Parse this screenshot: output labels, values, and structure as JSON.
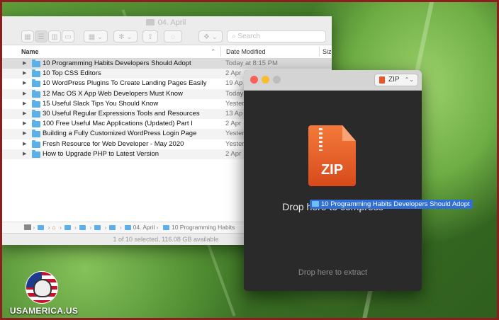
{
  "finder": {
    "title": "04. April",
    "search_placeholder": "Search",
    "columns": {
      "name": "Name",
      "date": "Date Modified",
      "size": "Size"
    },
    "rows": [
      {
        "name": "10 Programming Habits Developers Should Adopt",
        "date": "Today at 8:15 PM",
        "selected": true
      },
      {
        "name": "10 Top CSS Editors",
        "date": "2 Apr"
      },
      {
        "name": "10 WordPress Plugins To Create Landing Pages Easily",
        "date": "19 Ap"
      },
      {
        "name": "12 Mac OS X App Web Developers Must Know",
        "date": "Today"
      },
      {
        "name": "15 Useful Slack Tips You Should Know",
        "date": "Yester"
      },
      {
        "name": "30 Useful Regular Expressions Tools and Resources",
        "date": "13 Ap"
      },
      {
        "name": "100 Free Useful Mac Applications (Updated) Part I",
        "date": "2 Apr"
      },
      {
        "name": "Building a Fully Customized WordPress Login Page",
        "date": "Yester"
      },
      {
        "name": "Fresh Resource for Web Developer - May 2020",
        "date": "Yester"
      },
      {
        "name": "How to Upgrade PHP to Latest Version",
        "date": "2 Apr"
      }
    ],
    "path_items": [
      "04. April",
      "10 Programming Habits"
    ],
    "status": "1 of 10 selected, 116.08 GB available"
  },
  "archiver": {
    "format": "ZIP",
    "icon_label": "ZIP",
    "drop_compress": "Drop here to compress",
    "drop_extract": "Drop here to extract"
  },
  "drag": {
    "label": "10 Programming Habits Developers Should Adopt"
  },
  "logo": {
    "text": "USAMERICA.US"
  },
  "colors": {
    "selection": "#2f6fd6",
    "folder": "#5bb0ea",
    "zip": "#e8572b"
  }
}
